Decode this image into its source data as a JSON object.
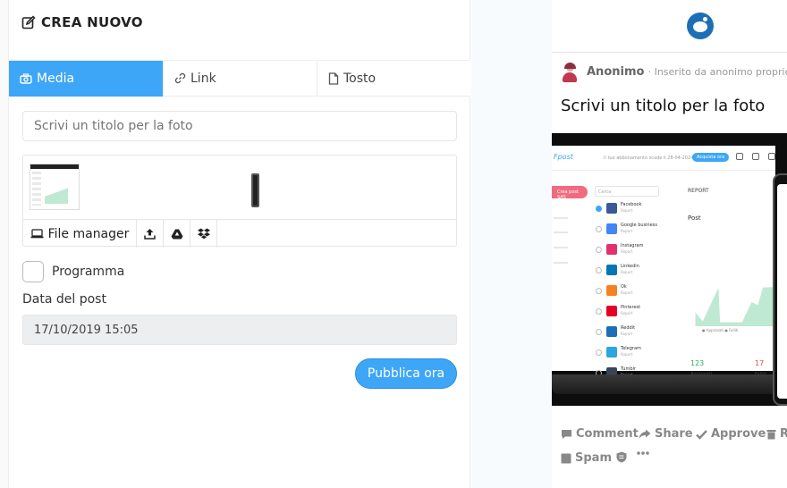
{
  "editor": {
    "header_title": "CREA NUOVO",
    "tabs": [
      {
        "label": "Media",
        "icon": "camera-icon",
        "active": true
      },
      {
        "label": "Link",
        "icon": "link-icon",
        "active": false
      },
      {
        "label": "Tosto",
        "icon": "file-icon",
        "active": false
      }
    ],
    "title_placeholder": "Scrivi un titolo per la foto",
    "media_tools": {
      "file_manager_label": "File manager",
      "icons": [
        "upload-icon",
        "google-drive-icon",
        "dropbox-icon"
      ]
    },
    "schedule_label": "Programma",
    "schedule_checked": false,
    "date_label": "Data del post",
    "date_value": "17/10/2019 15:05",
    "publish_label": "Pubblica ora"
  },
  "preview": {
    "network_icon": "reddit-icon",
    "username": "Anonimo",
    "subtitle": "· Inserito da anonimo proprio ora",
    "post_title": "Scrivi un titolo per la foto",
    "image": {
      "topbar_brand": "Fpost",
      "topbar_notice": "Il tuo abbonamento scade il 28-04-2024",
      "topbar_button": "Acquista ora",
      "create_button": "Crea post SAS",
      "search_placeholder": "Cerca",
      "report_heading": "REPORT",
      "post_heading": "Post",
      "accounts": [
        {
          "name": "Facebook",
          "sub": "Report",
          "color": "#3b5998",
          "checked": true
        },
        {
          "name": "Google business",
          "sub": "Report",
          "color": "#4285f4",
          "checked": false
        },
        {
          "name": "Instagram",
          "sub": "Report",
          "color": "#e1306c",
          "checked": false
        },
        {
          "name": "Linkedin",
          "sub": "Report",
          "color": "#0077b5",
          "checked": false
        },
        {
          "name": "Ok",
          "sub": "Report",
          "color": "#f58220",
          "checked": false
        },
        {
          "name": "Pinterest",
          "sub": "Report",
          "color": "#e60023",
          "checked": false
        },
        {
          "name": "Reddit",
          "sub": "Report",
          "color": "#1d6fb5",
          "checked": false
        },
        {
          "name": "Telegram",
          "sub": "Report",
          "color": "#2ca5e0",
          "checked": false
        },
        {
          "name": "Tumblr",
          "sub": "Report",
          "color": "#35465c",
          "checked": false
        }
      ],
      "legend": "● Approvati  ● Falliti",
      "approved_value": "123",
      "failed_value": "17",
      "approved_label": "Approvati",
      "failed_label": "Falliti"
    },
    "actions": [
      {
        "label": "Comment",
        "icon": "comment-icon"
      },
      {
        "label": "Share",
        "icon": "share-icon"
      },
      {
        "label": "Approve",
        "icon": "check-icon"
      },
      {
        "label": "Re",
        "icon": "trash-icon"
      },
      {
        "label": "Spam",
        "icon": "spam-icon"
      },
      {
        "label": "",
        "icon": "shield-icon"
      },
      {
        "label": "",
        "icon": "more-icon"
      }
    ]
  },
  "colors": {
    "accent": "#3ea6f6",
    "reddit_blue": "#1d6fb5",
    "date_field_bg": "#eceeef"
  }
}
